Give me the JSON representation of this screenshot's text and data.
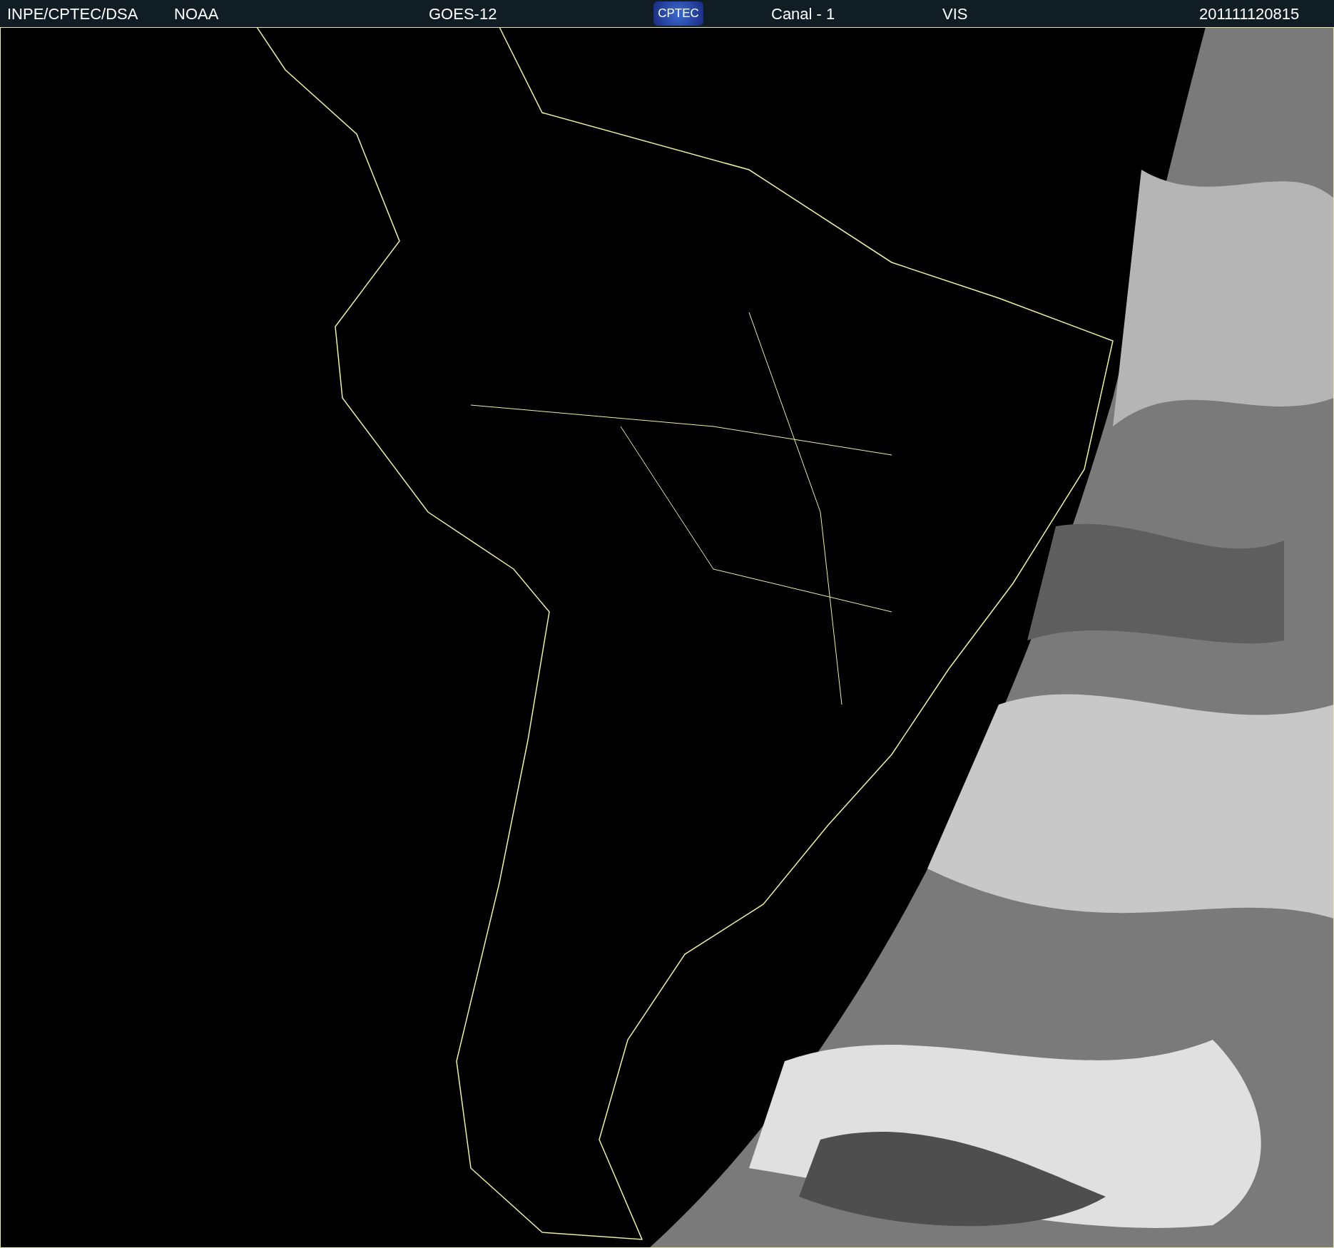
{
  "header": {
    "source": "INPE/CPTEC/DSA",
    "agency": "NOAA",
    "satellite": "GOES-12",
    "logo_text": "CPTEC",
    "channel": "Canal - 1",
    "band": "VIS",
    "timestamp": "201111120815"
  }
}
